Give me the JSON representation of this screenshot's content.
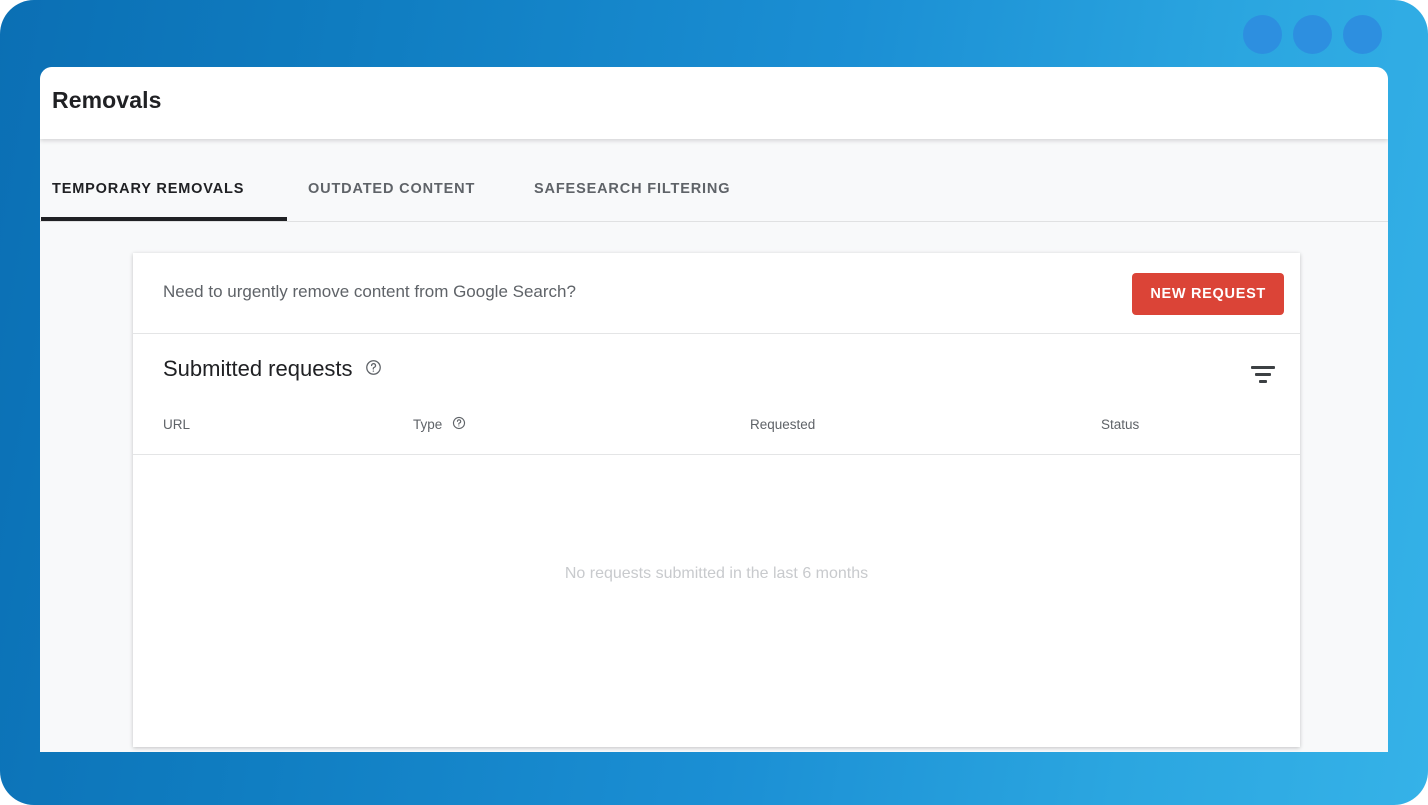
{
  "window": {
    "decorative_dots": [
      "dot-1",
      "dot-2",
      "dot-3"
    ],
    "background_start_color": "#0b6fb4",
    "background_end_color": "#35b2e8",
    "dot_color": "#2d8fe0"
  },
  "header": {
    "title": "Removals"
  },
  "tabs": [
    {
      "label": "TEMPORARY REMOVALS",
      "active": true
    },
    {
      "label": "OUTDATED CONTENT",
      "active": false
    },
    {
      "label": "SAFESEARCH FILTERING",
      "active": false
    }
  ],
  "banner": {
    "prompt": "Need to urgently remove content from Google Search?",
    "button_label": "NEW REQUEST",
    "button_color": "#db4437"
  },
  "submitted": {
    "title": "Submitted requests",
    "help_icon": "help-circle-icon",
    "filter_icon": "filter-list-icon"
  },
  "table": {
    "columns": [
      {
        "label": "URL",
        "help": false
      },
      {
        "label": "Type",
        "help": true
      },
      {
        "label": "Requested",
        "help": false
      },
      {
        "label": "Status",
        "help": false
      }
    ],
    "rows": [],
    "empty_message": "No requests submitted in the last 6 months"
  }
}
